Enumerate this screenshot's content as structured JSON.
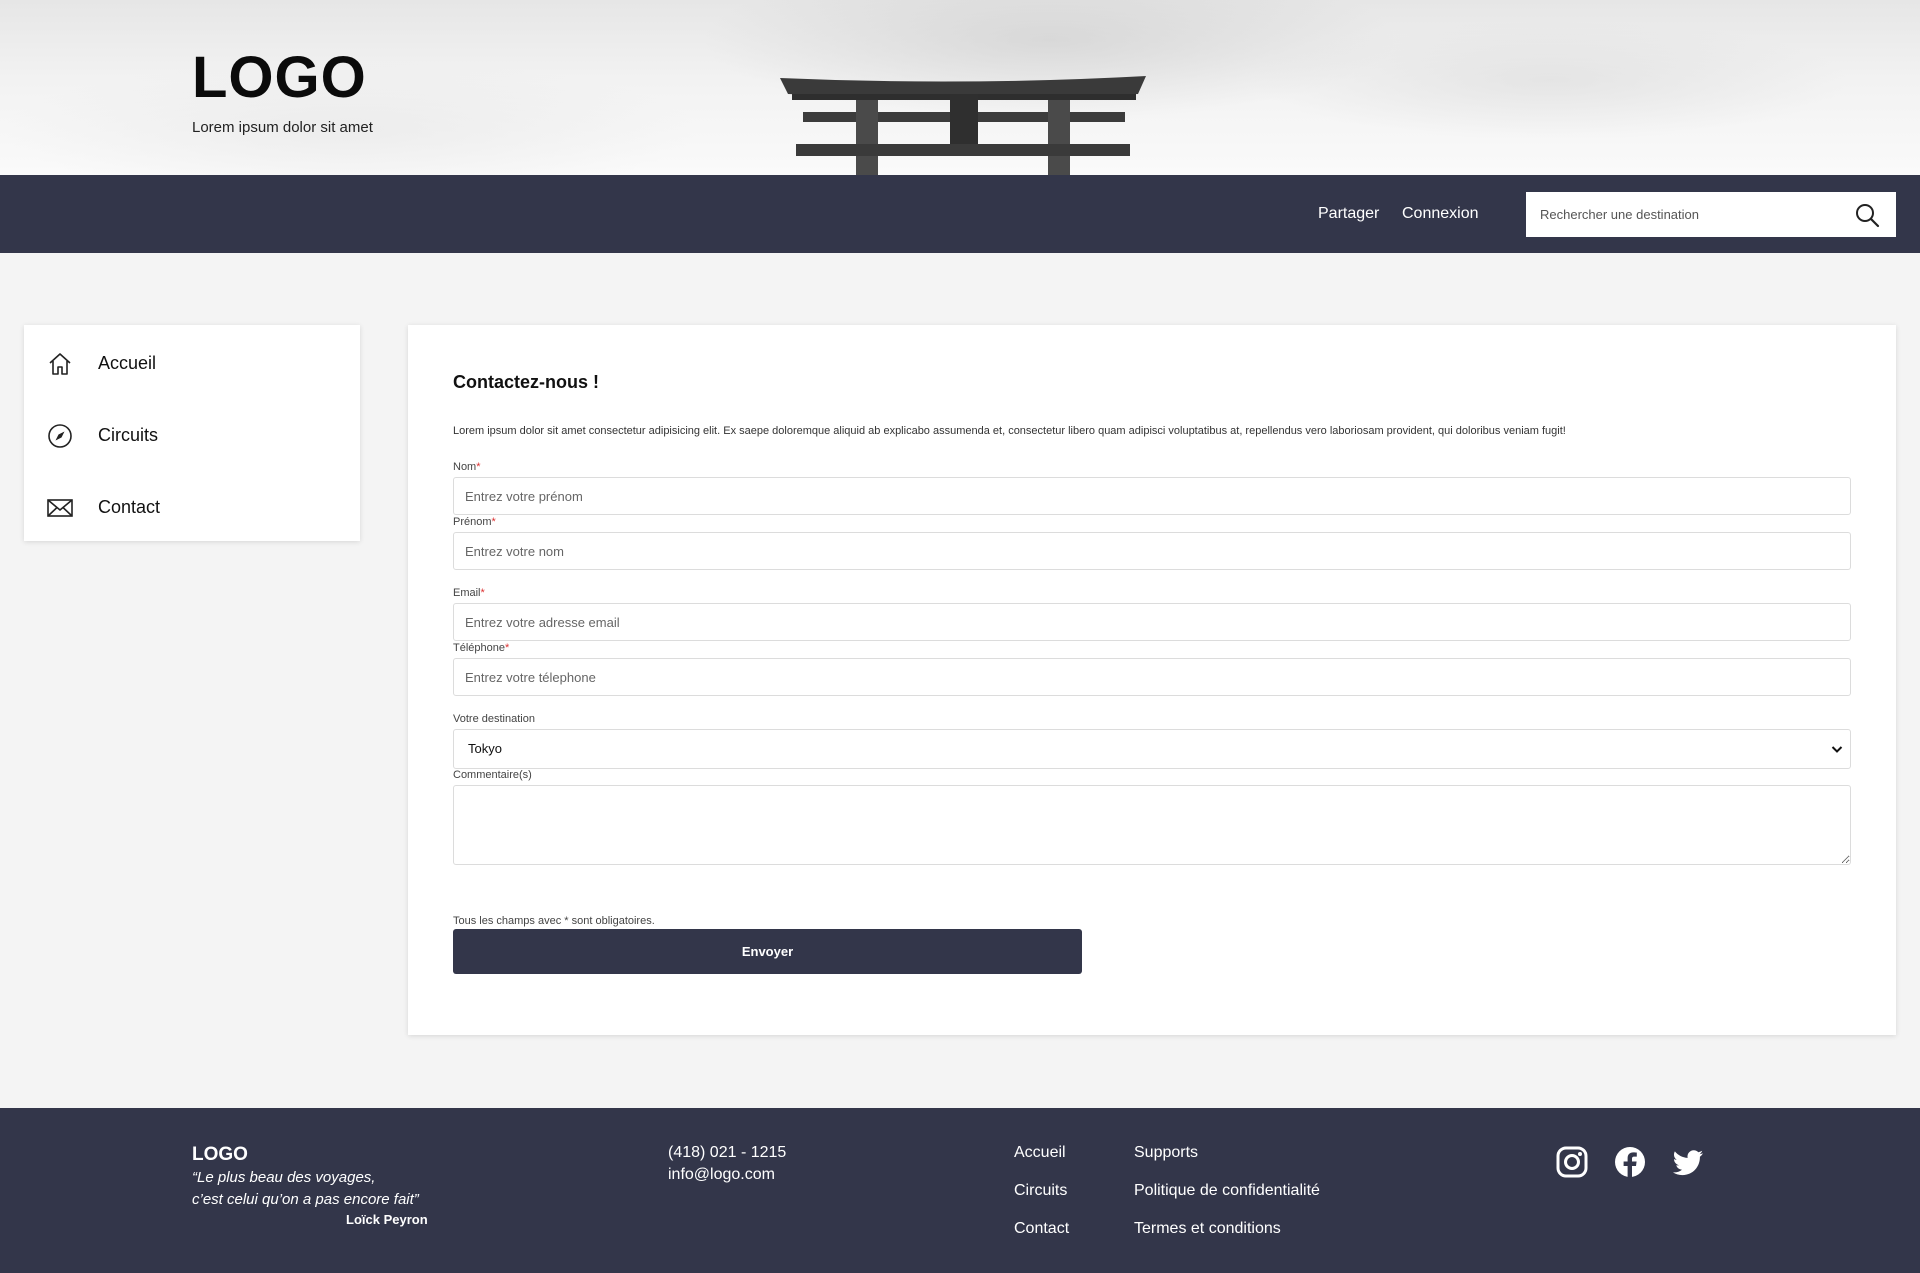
{
  "header": {
    "logo": "LOGO",
    "tagline": "Lorem ipsum dolor sit amet"
  },
  "navbar": {
    "share_label": "Partager",
    "login_label": "Connexion",
    "search_placeholder": "Rechercher une destination"
  },
  "sidebar": {
    "items": [
      {
        "label": "Accueil",
        "icon": "home-icon"
      },
      {
        "label": "Circuits",
        "icon": "compass-icon"
      },
      {
        "label": "Contact",
        "icon": "envelope-icon"
      }
    ]
  },
  "form": {
    "title": "Contactez-nous !",
    "intro": "Lorem ipsum dolor sit amet consectetur adipisicing elit. Ex saepe doloremque aliquid ab explicabo assumenda et, consectetur libero quam adipisci voluptatibus at, repellendus vero laboriosam provident, qui doloribus veniam fugit!",
    "required_mark": "*",
    "fields": {
      "nom": {
        "label": "Nom",
        "placeholder": "Entrez votre prénom"
      },
      "prenom": {
        "label": "Prénom",
        "placeholder": "Entrez votre nom"
      },
      "email": {
        "label": "Email",
        "placeholder": "Entrez votre adresse email"
      },
      "telephone": {
        "label": "Téléphone",
        "placeholder": "Entrez votre télephone"
      },
      "destination": {
        "label": "Votre destination",
        "value": "Tokyo"
      },
      "commentaire": {
        "label": "Commentaire(s)"
      }
    },
    "mandatory_note": "Tous les champs avec * sont obligatoires.",
    "submit_label": "Envoyer"
  },
  "footer": {
    "logo": "LOGO",
    "quote_line1": "“Le plus beau des voyages,",
    "quote_line2": "c’est celui qu’on a pas encore fait”",
    "quote_author": "Loïck Peyron",
    "phone": "(418) 021 - 1215",
    "email": "info@logo.com",
    "links": [
      "Accueil",
      "Circuits",
      "Contact",
      "Supports",
      "Politique de confidentialité",
      "Termes et conditions"
    ],
    "social": [
      "instagram-icon",
      "facebook-icon",
      "twitter-icon"
    ]
  },
  "colors": {
    "primary": "#33364a",
    "background": "#f4f4f4",
    "required": "#dd3333"
  }
}
